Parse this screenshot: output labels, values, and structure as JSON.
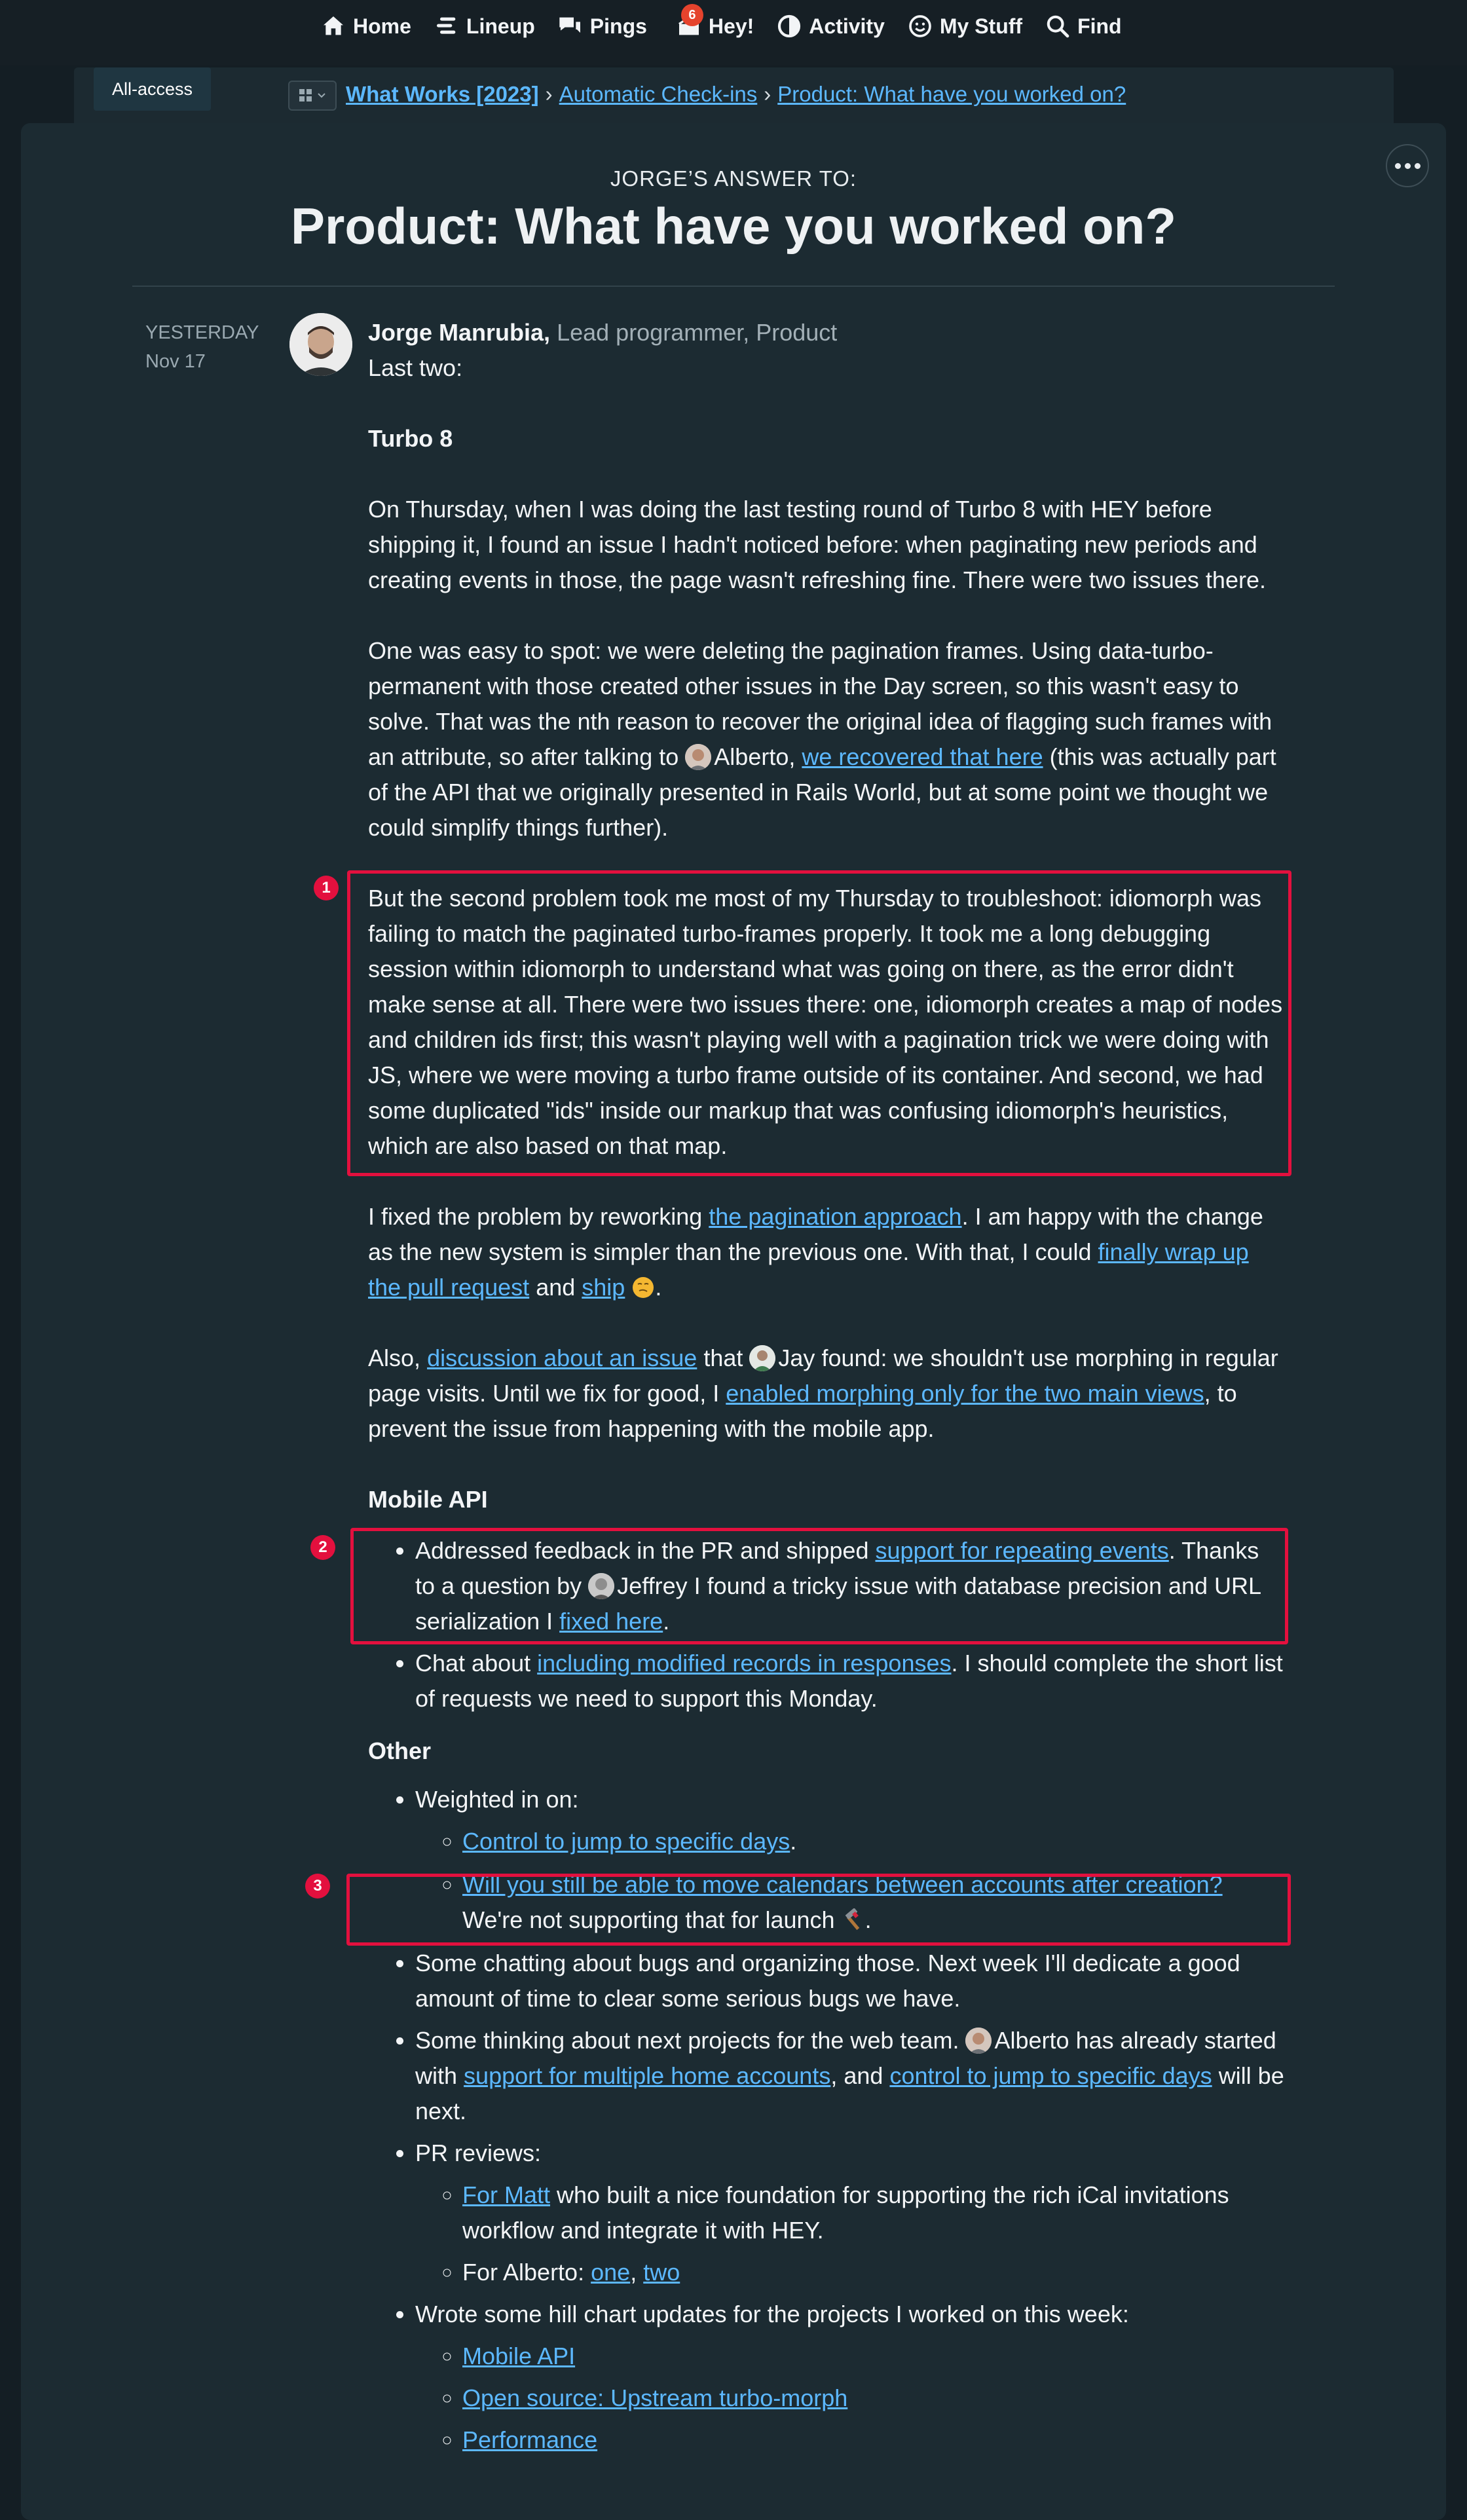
{
  "nav": {
    "items": [
      {
        "label": "Home",
        "icon": "home-icon"
      },
      {
        "label": "Lineup",
        "icon": "lineup-icon"
      },
      {
        "label": "Pings",
        "icon": "pings-icon"
      },
      {
        "label": "Hey!",
        "icon": "hey-icon",
        "badge": "6"
      },
      {
        "label": "Activity",
        "icon": "activity-icon"
      },
      {
        "label": "My Stuff",
        "icon": "smiley-icon"
      },
      {
        "label": "Find",
        "icon": "search-icon"
      }
    ]
  },
  "breadcrumb": {
    "access": "All-access",
    "project": "What Works [2023]",
    "tool": "Automatic Check-ins",
    "question": "Product: What have you worked on?"
  },
  "header": {
    "eyebrow": "JORGE’S ANSWER TO:",
    "title": "Product: What have you worked on?"
  },
  "post": {
    "date_relative": "YESTERDAY",
    "date": "Nov 17",
    "author": "Jorge Manrubia,",
    "role": "Lead programmer, Product",
    "intro": "Last two:",
    "turbo_heading": "Turbo 8",
    "p1": "On Thursday, when I was doing the last testing round of Turbo 8 with HEY before shipping it, I found an issue I hadn't noticed before: when paginating new periods and creating events in those, the page wasn't refreshing fine. There were two issues there.",
    "p2_a": "One was easy to spot: we were deleting the pagination frames. Using data-turbo-permanent with those created other issues in the Day screen, so this wasn't easy to solve. That was the nth reason to recover the original idea of flagging such frames with an attribute, so after talking to",
    "p2_person": "Alberto,",
    "p2_link": "we recovered that here",
    "p2_b": "(this was actually part of the API that we originally presented in Rails World, but at some point we thought we could simplify things further).",
    "p3": "But the second problem took me most of my Thursday to troubleshoot: idiomorph was failing to match the paginated turbo-frames properly. It took me a long debugging session within idiomorph to understand what was going on there, as the error didn't make sense at all. There were two issues there: one, idiomorph creates a map of nodes and children ids first; this wasn't playing well with a pagination trick we were doing with JS, where we were moving a turbo frame outside of its container. And second, we had some duplicated \"ids\" inside our markup that was confusing idiomorph's heuristics, which are also based on that map.",
    "p4_a": "I fixed the problem by reworking",
    "p4_link1": "the pagination approach",
    "p4_b": ". I am happy with the change as the new system is simpler than the previous one. With that, I could",
    "p4_link2": "finally wrap up the pull request",
    "p4_c": "and",
    "p4_link3": "ship",
    "p4_d": ".",
    "p5_a": "Also,",
    "p5_link1": "discussion about an issue",
    "p5_b": "that",
    "p5_person": "Jay",
    "p5_c": "found: we shouldn't use morphing in regular page visits. Until we fix for good, I",
    "p5_link2": "enabled morphing only for the two main views",
    "p5_d": ", to prevent the issue from happening with the mobile app.",
    "mobile_heading": "Mobile API",
    "m1_a": "Addressed feedback in the PR and shipped",
    "m1_link1": "support for repeating events",
    "m1_b": ". Thanks to a question by",
    "m1_person": "Jeffrey",
    "m1_c": "I found a tricky issue with database precision and URL serialization I",
    "m1_link2": "fixed here",
    "m1_d": ".",
    "m2_a": "Chat about",
    "m2_link": "including modified records in responses",
    "m2_b": ". I should complete the short list of requests we need to support this Monday.",
    "other_heading": "Other",
    "o1": "Weighted in on:",
    "o1_sub1_link": "Control to jump to specific days",
    "o1_sub1_end": ".",
    "o1_sub2_link": "Will you still be able to move calendars between accounts after creation?",
    "o1_sub2_text": "We're not supporting that for launch",
    "o1_sub2_end": ".",
    "o2": "Some chatting about bugs and organizing those. Next week I'll dedicate a good amount of time to clear some serious bugs we have.",
    "o3_a": "Some thinking about next projects for the web team.",
    "o3_person": "Alberto",
    "o3_b": "has already started with",
    "o3_link1": "support for multiple home accounts",
    "o3_c": ", and",
    "o3_link2": "control to jump to specific days",
    "o3_d": "will be next.",
    "o4": "PR reviews:",
    "o4_sub1_link": "For Matt",
    "o4_sub1_text": "who built a nice foundation for supporting the rich iCal invitations workflow and integrate it with HEY.",
    "o4_sub2_text": "For Alberto:",
    "o4_sub2_link1": "one",
    "o4_sub2_sep": ",",
    "o4_sub2_link2": "two",
    "o5": "Wrote some hill chart updates for the projects I worked on this week:",
    "o5_sub1": "Mobile API",
    "o5_sub2": "Open source: Upstream turbo-morph",
    "o5_sub3": "Performance"
  },
  "annotations": [
    "1",
    "2",
    "3"
  ],
  "colors": {
    "accent": "#e3103e",
    "link": "#5cb8ff",
    "background": "#1c2b32"
  }
}
